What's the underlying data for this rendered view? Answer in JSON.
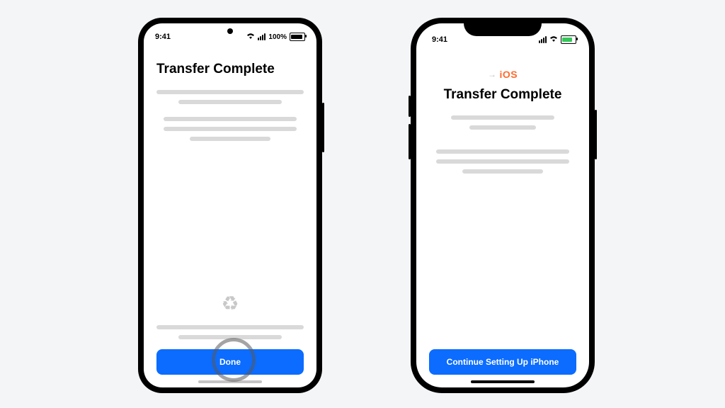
{
  "android": {
    "status": {
      "time": "9:41",
      "batteryText": "100%"
    },
    "title": "Transfer Complete",
    "recycleIcon": "♻",
    "button": "Done"
  },
  "iphone": {
    "status": {
      "time": "9:41"
    },
    "badge": {
      "arrow": "→",
      "text": "iOS"
    },
    "title": "Transfer Complete",
    "button": "Continue Setting Up iPhone"
  }
}
